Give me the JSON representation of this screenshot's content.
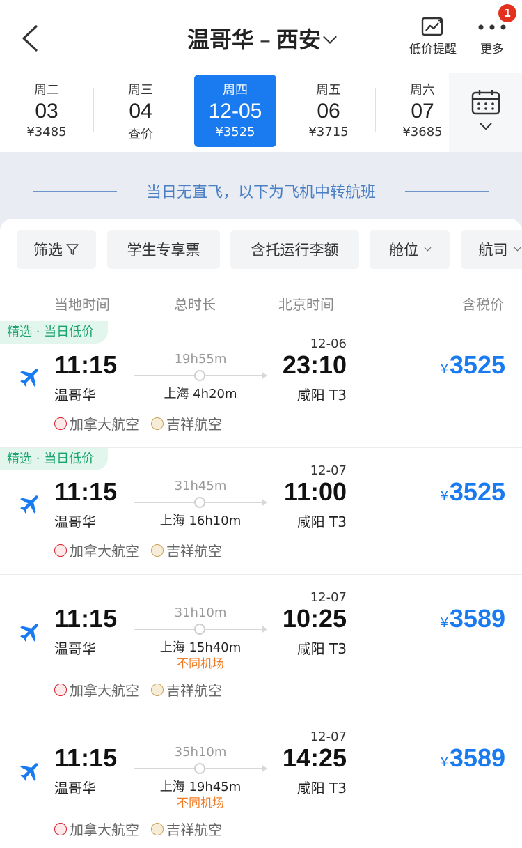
{
  "header": {
    "origin": "温哥华",
    "destination": "西安",
    "separator": "–",
    "price_alert_label": "低价提醒",
    "more_label": "更多",
    "badge_count": "1"
  },
  "dates": [
    {
      "weekday": "周二",
      "day": "03",
      "price": "¥3485",
      "active": false
    },
    {
      "weekday": "周三",
      "day": "04",
      "price": "查价",
      "active": false
    },
    {
      "weekday": "周四",
      "day": "12-05",
      "price": "¥3525",
      "active": true
    },
    {
      "weekday": "周五",
      "day": "06",
      "price": "¥3715",
      "active": false
    },
    {
      "weekday": "周六",
      "day": "07",
      "price": "¥3685",
      "active": false
    }
  ],
  "notice": "当日无直飞，以下为飞机中转航班",
  "filters": {
    "filter": "筛选",
    "student": "学生专享票",
    "baggage": "含托运行李额",
    "cabin": "舱位",
    "airline": "航司"
  },
  "columns": {
    "local_time": "当地时间",
    "total_duration": "总时长",
    "beijing_time": "北京时间",
    "price_incl_tax": "含税价"
  },
  "flights": [
    {
      "tag": "精选 · 当日低价",
      "dep_time": "11:15",
      "dep_city": "温哥华",
      "duration": "19h55m",
      "transit": "上海 4h20m",
      "different_airport": "",
      "arr_date": "12-06",
      "arr_time": "23:10",
      "arr_city": "咸阳 T3",
      "currency": "¥",
      "price": "3525",
      "airline1": "加拿大航空",
      "airline2": "吉祥航空"
    },
    {
      "tag": "精选 · 当日低价",
      "dep_time": "11:15",
      "dep_city": "温哥华",
      "duration": "31h45m",
      "transit": "上海 16h10m",
      "different_airport": "",
      "arr_date": "12-07",
      "arr_time": "11:00",
      "arr_city": "咸阳 T3",
      "currency": "¥",
      "price": "3525",
      "airline1": "加拿大航空",
      "airline2": "吉祥航空"
    },
    {
      "tag": "",
      "dep_time": "11:15",
      "dep_city": "温哥华",
      "duration": "31h10m",
      "transit": "上海 15h40m",
      "different_airport": "不同机场",
      "arr_date": "12-07",
      "arr_time": "10:25",
      "arr_city": "咸阳 T3",
      "currency": "¥",
      "price": "3589",
      "airline1": "加拿大航空",
      "airline2": "吉祥航空"
    },
    {
      "tag": "",
      "dep_time": "11:15",
      "dep_city": "温哥华",
      "duration": "35h10m",
      "transit": "上海 19h45m",
      "different_airport": "不同机场",
      "arr_date": "12-07",
      "arr_time": "14:25",
      "arr_city": "咸阳 T3",
      "currency": "¥",
      "price": "3589",
      "airline1": "加拿大航空",
      "airline2": "吉祥航空"
    }
  ],
  "colors": {
    "accent": "#1a7bf0",
    "tag_green": "#18a46e",
    "warning_orange": "#f07a22",
    "air_canada_red": "#d81e2a",
    "juneyao_gold": "#c9a25a"
  }
}
